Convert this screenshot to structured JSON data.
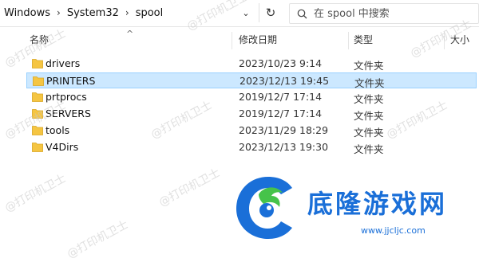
{
  "addressbar": {
    "crumbs": [
      "Windows",
      "System32",
      "spool"
    ],
    "dropdown_glyph": "⌄",
    "refresh_glyph": "↻",
    "search_placeholder": "在 spool 中搜索"
  },
  "columns": {
    "name": "名称",
    "modified": "修改日期",
    "type": "类型",
    "size": "大小",
    "sort_glyph": "^"
  },
  "rows": [
    {
      "name": "drivers",
      "modified": "2023/10/23 9:14",
      "type": "文件夹",
      "selected": false
    },
    {
      "name": "PRINTERS",
      "modified": "2023/12/13 19:45",
      "type": "文件夹",
      "selected": true
    },
    {
      "name": "prtprocs",
      "modified": "2019/12/7 17:14",
      "type": "文件夹",
      "selected": false
    },
    {
      "name": "SERVERS",
      "modified": "2019/12/7 17:14",
      "type": "文件夹",
      "selected": false
    },
    {
      "name": "tools",
      "modified": "2023/11/29 18:29",
      "type": "文件夹",
      "selected": false
    },
    {
      "name": "V4Dirs",
      "modified": "2023/12/13 19:30",
      "type": "文件夹",
      "selected": false
    }
  ],
  "watermarks": {
    "text": "@打印机卫士"
  },
  "logo": {
    "text": "底隆游戏网",
    "url": "www.jjcljc.com"
  },
  "colors": {
    "selected_bg": "#cce8ff",
    "selected_border": "#99d1ff",
    "folder": "#f5c542",
    "logo_blue": "#1a6fd8",
    "logo_green": "#46c34a"
  }
}
